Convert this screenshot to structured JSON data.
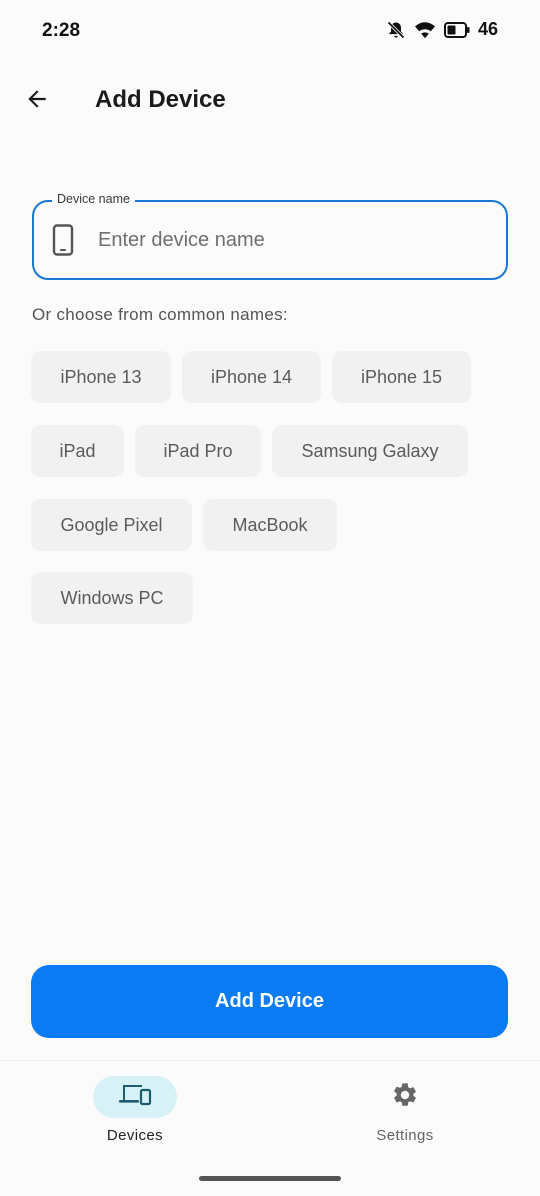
{
  "status_bar": {
    "time": "2:28",
    "battery_level": "46",
    "icons": [
      "mute-icon",
      "wifi-icon",
      "battery-icon"
    ]
  },
  "app_bar": {
    "back_icon": "arrow-back-icon",
    "title": "Add Device"
  },
  "device_name_field": {
    "label": "Device name",
    "placeholder": "Enter device name",
    "value": "",
    "icon": "phone-icon"
  },
  "suggestions": {
    "label": "Or choose from common names:",
    "chips": [
      "iPhone 13",
      "iPhone 14",
      "iPhone 15",
      "iPad",
      "iPad Pro",
      "Samsung Galaxy",
      "Google Pixel",
      "MacBook",
      "Windows PC"
    ]
  },
  "primary_button": {
    "label": "Add Device"
  },
  "bottom_nav": {
    "items": [
      {
        "label": "Devices",
        "icon": "devices-icon",
        "active": true
      },
      {
        "label": "Settings",
        "icon": "gear-icon",
        "active": false
      }
    ]
  },
  "colors": {
    "accent": "#0a7bf2",
    "field_border": "#1877d6",
    "nav_active_bg": "#d6f2f7",
    "chip_bg": "#f1f1f1",
    "background": "#fbfbfb"
  }
}
